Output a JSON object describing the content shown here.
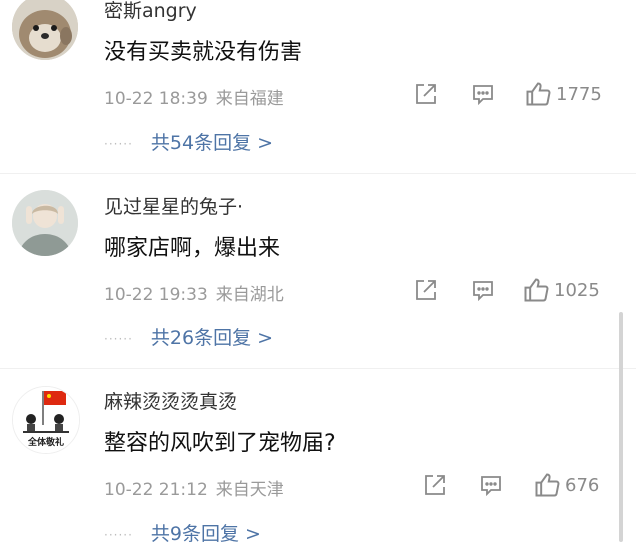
{
  "comments": [
    {
      "username": "密斯angry",
      "content": "没有买卖就没有伤害",
      "time": "10-22 18:39",
      "location": "来自福建",
      "likes": "1775",
      "replies": "共54条回复 >"
    },
    {
      "username": "见过星星的兔子·",
      "content": "哪家店啊，爆出来",
      "time": "10-22 19:33",
      "location": "来自湖北",
      "likes": "1025",
      "replies": "共26条回复 >"
    },
    {
      "username": "麻辣烫烫烫真烫",
      "content": "整容的风吹到了宠物届?",
      "time": "10-22 21:12",
      "location": "来自天津",
      "likes": "676",
      "replies": "共9条回复 >",
      "avatar_text": "全体敬礼"
    }
  ],
  "reply_dots": "······",
  "colors": {
    "link": "#4e74a6",
    "meta": "#9a9a9a",
    "text": "#111111"
  },
  "icons": [
    "share-icon",
    "comment-icon",
    "like-icon"
  ]
}
